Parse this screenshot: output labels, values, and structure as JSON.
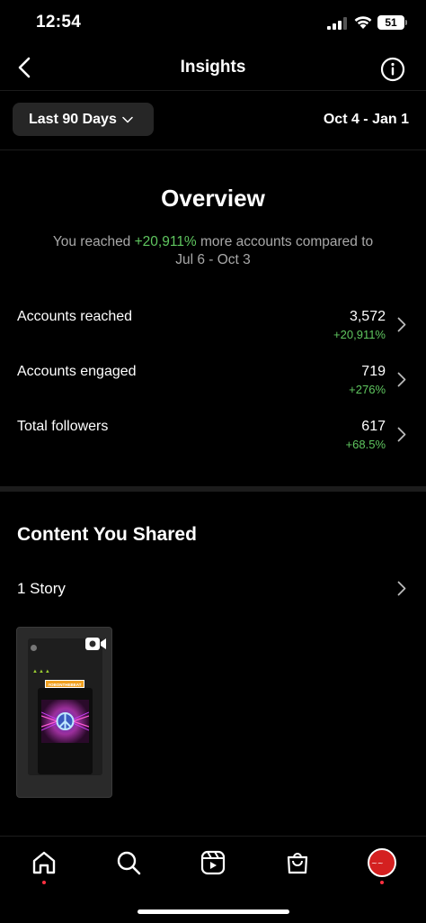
{
  "status_bar": {
    "time": "12:54",
    "battery": "51"
  },
  "header": {
    "title": "Insights",
    "icons": [
      "chevron-left-icon",
      "info-icon"
    ]
  },
  "filter": {
    "period_label": "Last 90 Days",
    "date_range": "Oct 4 - Jan 1"
  },
  "overview": {
    "title": "Overview",
    "summary_prefix": "You reached ",
    "summary_highlight": "+20,911%",
    "summary_suffix": " more accounts compared to",
    "summary_line2": "Jul 6 - Oct 3",
    "metrics": [
      {
        "label": "Accounts reached",
        "value": "3,572",
        "change": "+20,911%"
      },
      {
        "label": "Accounts engaged",
        "value": "719",
        "change": "+276%"
      },
      {
        "label": "Total followers",
        "value": "617",
        "change": "+68.5%"
      }
    ]
  },
  "content_shared": {
    "title": "Content You Shared",
    "story_label": "1 Story",
    "thumbnail": {
      "tag": "#OBONTHEBEAT"
    }
  },
  "tab_bar": {
    "items": [
      "home-icon",
      "search-icon",
      "reels-icon",
      "shop-icon",
      "profile-avatar"
    ],
    "accent": "#ff3040"
  },
  "colors": {
    "background": "#000000",
    "positive": "#5fc65f",
    "muted_text": "#a8a8a8",
    "button_bg": "#262626"
  }
}
